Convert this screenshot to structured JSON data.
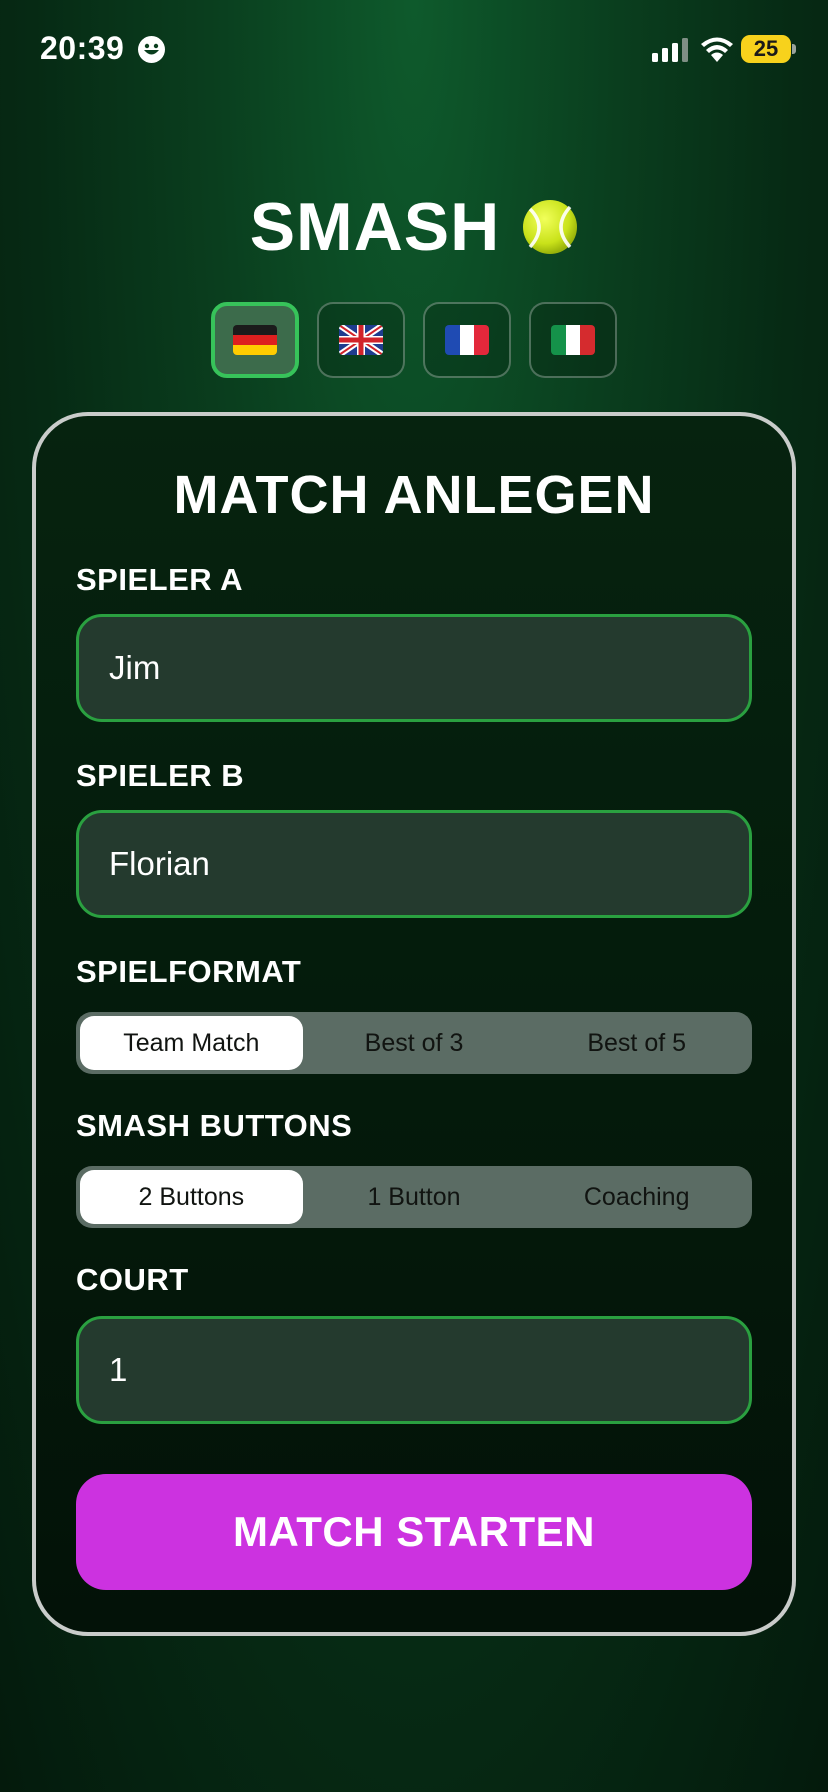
{
  "status_bar": {
    "time": "20:39",
    "battery_level": "25",
    "status_emoji_icon": "grinning-face-icon",
    "battery_color": "#f7d21c"
  },
  "app": {
    "title": "SMASH",
    "title_icon": "tennis-ball-icon"
  },
  "languages": [
    {
      "code": "de",
      "flag_icon": "flag-germany-icon",
      "selected": true
    },
    {
      "code": "en",
      "flag_icon": "flag-uk-icon",
      "selected": false
    },
    {
      "code": "fr",
      "flag_icon": "flag-france-icon",
      "selected": false
    },
    {
      "code": "it",
      "flag_icon": "flag-italy-icon",
      "selected": false
    }
  ],
  "form": {
    "title": "MATCH ANLEGEN",
    "player_a_label": "SPIELER A",
    "player_a_value": "Jim",
    "player_b_label": "SPIELER B",
    "player_b_value": "Florian",
    "format_label": "SPIELFORMAT",
    "format_options": [
      "Team Match",
      "Best of 3",
      "Best of 5"
    ],
    "format_selected": "Team Match",
    "buttons_label": "SMASH BUTTONS",
    "buttons_options": [
      "2 Buttons",
      "1 Button",
      "Coaching"
    ],
    "buttons_selected": "2 Buttons",
    "court_label": "COURT",
    "court_value": "1",
    "start_button": "MATCH STARTEN"
  },
  "colors": {
    "accent_green": "#37c35a",
    "field_border": "#2aa040",
    "start_button": "#cc32e0",
    "background": "#0a3e1e"
  }
}
